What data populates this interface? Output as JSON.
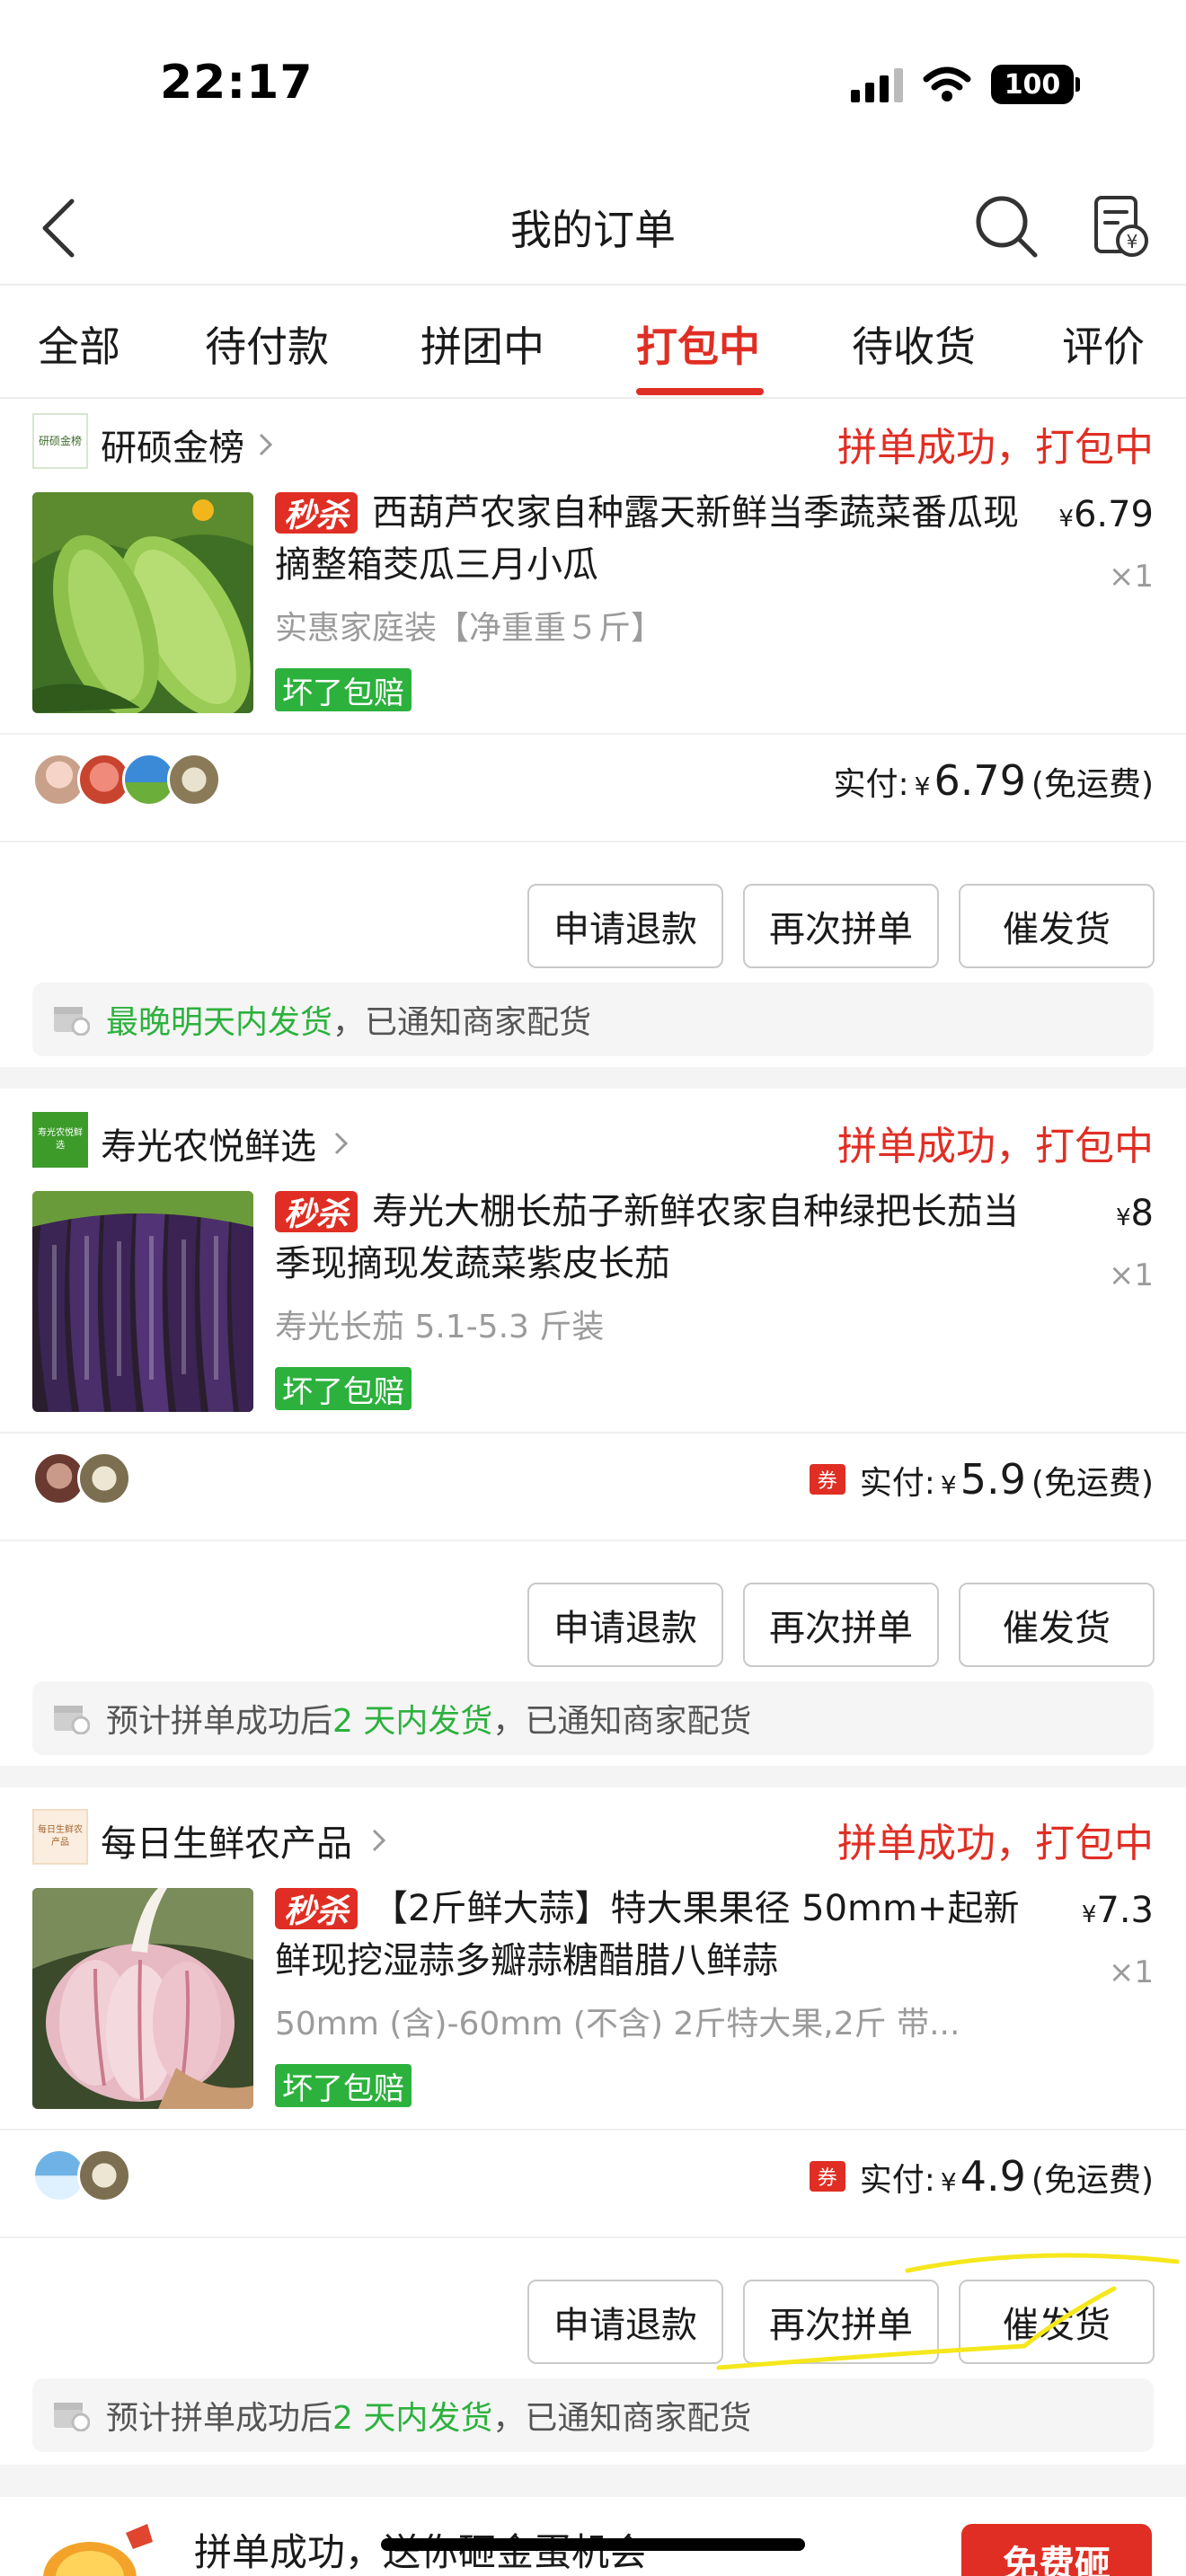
{
  "status_bar": {
    "time": "22:17",
    "battery": "100",
    "icons": [
      "signal-icon",
      "wifi-icon",
      "battery-icon"
    ]
  },
  "header": {
    "title": "我的订单",
    "icons": [
      "back-icon",
      "search-icon",
      "bill-icon"
    ]
  },
  "tabs": [
    {
      "label": "全部",
      "active": false
    },
    {
      "label": "待付款",
      "active": false
    },
    {
      "label": "拼团中",
      "active": false
    },
    {
      "label": "打包中",
      "active": true
    },
    {
      "label": "待收货",
      "active": false
    },
    {
      "label": "评价",
      "active": false
    }
  ],
  "orders": [
    {
      "store_name": "研硕金榜",
      "store_logo_text": "研硕金榜",
      "status": "拼单成功，打包中",
      "flash_badge": "秒杀",
      "title": "西葫芦农家自种露天新鲜当季蔬菜番瓜现摘整箱茭瓜三月小瓜",
      "spec": "实惠家庭装【净重重５斤】",
      "guarantee": "坏了包赔",
      "price_symbol": "¥",
      "price": "6.79",
      "quantity": "×1",
      "paid_label": "实付:",
      "paid_symbol": "¥",
      "paid_amount": "6.79",
      "shipping": "(免运费)",
      "has_coupon": false,
      "buttons": [
        "申请退款",
        "再次拼单",
        "催发货"
      ],
      "notice": {
        "prefix": "",
        "highlight": "最晚明天内发货",
        "suffix": "，已通知商家配货"
      }
    },
    {
      "store_name": "寿光农悦鲜选",
      "store_logo_text": "寿光农悦鲜选",
      "status": "拼单成功，打包中",
      "flash_badge": "秒杀",
      "title": "寿光大棚长茄子新鲜农家自种绿把长茄当季现摘现发蔬菜紫皮长茄",
      "spec": "寿光长茄 5.1-5.3 斤装",
      "guarantee": "坏了包赔",
      "price_symbol": "¥",
      "price": "8",
      "quantity": "×1",
      "paid_label": "实付:",
      "paid_symbol": "¥",
      "paid_amount": "5.9",
      "shipping": "(免运费)",
      "has_coupon": true,
      "coupon_text": "券",
      "buttons": [
        "申请退款",
        "再次拼单",
        "催发货"
      ],
      "notice": {
        "prefix": "预计拼单成功后 ",
        "highlight": "2 天内发货",
        "suffix": "，已通知商家配货"
      }
    },
    {
      "store_name": "每日生鲜农产品",
      "store_logo_text": "每日生鲜农产品",
      "status": "拼单成功，打包中",
      "flash_badge": "秒杀",
      "title": "【2斤鲜大蒜】特大果果径 50mm+起新鲜现挖湿蒜多瓣蒜糖醋腊八鲜蒜",
      "spec": "50mm (含)-60mm (不含) 2斤特大果,2斤 带...",
      "guarantee": "坏了包赔",
      "price_symbol": "¥",
      "price": "7.3",
      "quantity": "×1",
      "paid_label": "实付:",
      "paid_symbol": "¥",
      "paid_amount": "4.9",
      "shipping": "(免运费)",
      "has_coupon": true,
      "coupon_text": "券",
      "buttons": [
        "申请退款",
        "再次拼单",
        "催发货"
      ],
      "notice": {
        "prefix": "预计拼单成功后 ",
        "highlight": "2 天内发货",
        "suffix": "，已通知商家配货"
      }
    }
  ],
  "promo": {
    "text": "拼单成功，送你砸金蛋机会",
    "button": "免费砸"
  },
  "colors": {
    "accent": "#e02e24",
    "green": "#2cb13d",
    "highlighter": "#f5e71c"
  }
}
